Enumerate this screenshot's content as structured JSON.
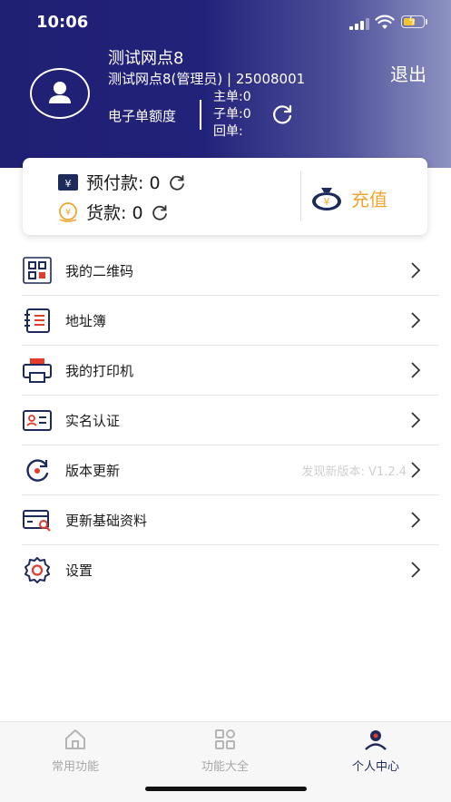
{
  "status_bar": {
    "time": "10:06"
  },
  "profile": {
    "name": "测试网点8",
    "subline": "测试网点8(管理员) | 25008001",
    "logout_label": "退出",
    "quota_label": "电子单额度",
    "quota_rows": [
      "主单:0",
      "子单:0",
      "回单:"
    ]
  },
  "balance_card": {
    "prepay_label": "预付款: 0",
    "goods_label": "货款: 0",
    "recharge_label": "充值"
  },
  "menu": {
    "items": [
      {
        "label": "我的二维码",
        "icon": "qrcode-icon",
        "note": ""
      },
      {
        "label": "地址簿",
        "icon": "address-book-icon",
        "note": ""
      },
      {
        "label": "我的打印机",
        "icon": "printer-icon",
        "note": ""
      },
      {
        "label": "实名认证",
        "icon": "id-card-icon",
        "note": ""
      },
      {
        "label": "版本更新",
        "icon": "update-icon",
        "note": "发现新版本: V1.2.4"
      },
      {
        "label": "更新基础资料",
        "icon": "data-update-icon",
        "note": ""
      },
      {
        "label": "设置",
        "icon": "gear-icon",
        "note": ""
      }
    ]
  },
  "tabbar": {
    "tabs": [
      {
        "label": "常用功能",
        "icon": "home-icon",
        "active": false
      },
      {
        "label": "功能大全",
        "icon": "grid-icon",
        "active": false
      },
      {
        "label": "个人中心",
        "icon": "person-icon",
        "active": true
      }
    ]
  },
  "colors": {
    "header_dark": "#1f1f73",
    "accent_orange": "#f0a532",
    "icon_navy": "#1e2a5a",
    "icon_red": "#e23c2a"
  }
}
